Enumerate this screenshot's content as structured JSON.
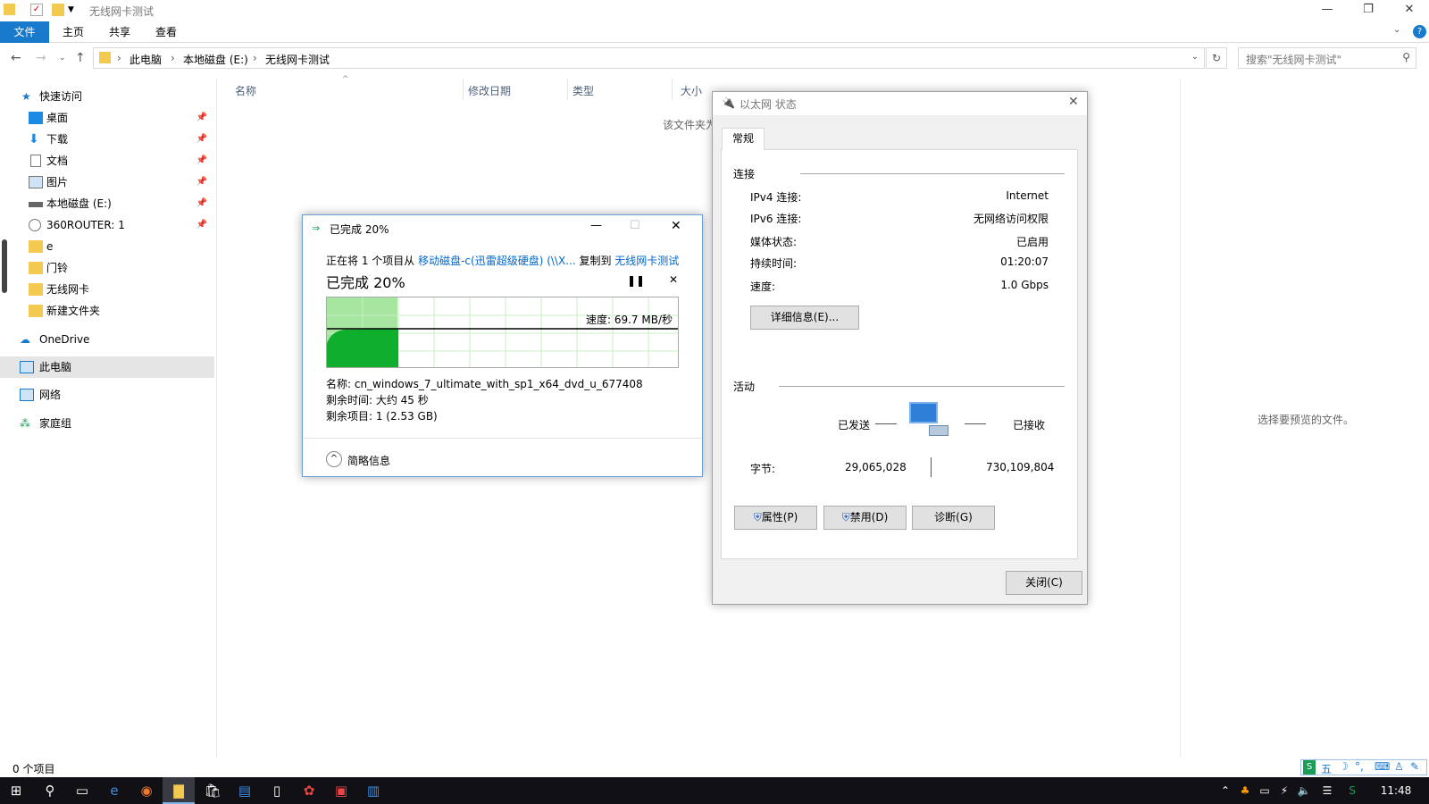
{
  "window": {
    "title": "无线网卡测试"
  },
  "ribbon": {
    "tabs": [
      "文件",
      "主页",
      "共享",
      "查看"
    ]
  },
  "address": {
    "crumbs": [
      "此电脑",
      "本地磁盘 (E:)",
      "无线网卡测试"
    ],
    "search_placeholder": "搜索\"无线网卡测试\""
  },
  "nav": {
    "quick_access": "快速访问",
    "items": [
      "桌面",
      "下载",
      "文档",
      "图片",
      "本地磁盘 (E:)",
      "360ROUTER: 1",
      "e",
      "门铃",
      "无线网卡",
      "新建文件夹"
    ],
    "onedrive": "OneDrive",
    "thispc": "此电脑",
    "network": "网络",
    "homegroup": "家庭组"
  },
  "content": {
    "columns": [
      "名称",
      "修改日期",
      "类型",
      "大小"
    ],
    "empty_text": "该文件夹为空。",
    "preview_text": "选择要预览的文件。"
  },
  "status": {
    "items": "0 个项目"
  },
  "copy_dialog": {
    "title": "已完成 20%",
    "line_prefix": "正在将 1 个项目从 ",
    "source": "移动磁盘-c(迅雷超级硬盘) (\\\\X...",
    "line_mid": " 复制到 ",
    "dest": "无线网卡测试",
    "progress_label": "已完成 20%",
    "progress": 0.2,
    "speed": "速度: 69.7 MB/秒",
    "name": "名称: cn_windows_7_ultimate_with_sp1_x64_dvd_u_677408",
    "time_left": "剩余时间: 大约 45 秒",
    "items_left": "剩余项目: 1 (2.53 GB)",
    "less_details": "简略信息",
    "pause_icon": "pause-icon",
    "cancel_icon": "close-icon"
  },
  "eth_dialog": {
    "title": "以太网 状态",
    "tab": "常规",
    "connection_group": "连接",
    "rows": [
      {
        "label": "IPv4 连接:",
        "value": "Internet"
      },
      {
        "label": "IPv6 连接:",
        "value": "无网络访问权限"
      },
      {
        "label": "媒体状态:",
        "value": "已启用"
      },
      {
        "label": "持续时间:",
        "value": "01:20:07"
      },
      {
        "label": "速度:",
        "value": "1.0 Gbps"
      }
    ],
    "details_button": "详细信息(E)...",
    "activity_group": "活动",
    "sent_label": "已发送",
    "received_label": "已接收",
    "bytes_label": "字节:",
    "sent_bytes": "29,065,028",
    "received_bytes": "730,109,804",
    "properties_button": "属性(P)",
    "disable_button": "禁用(D)",
    "diagnose_button": "诊断(G)",
    "close_button": "关闭(C)"
  },
  "taskbar": {
    "clock": "11:48",
    "ime": "五"
  }
}
